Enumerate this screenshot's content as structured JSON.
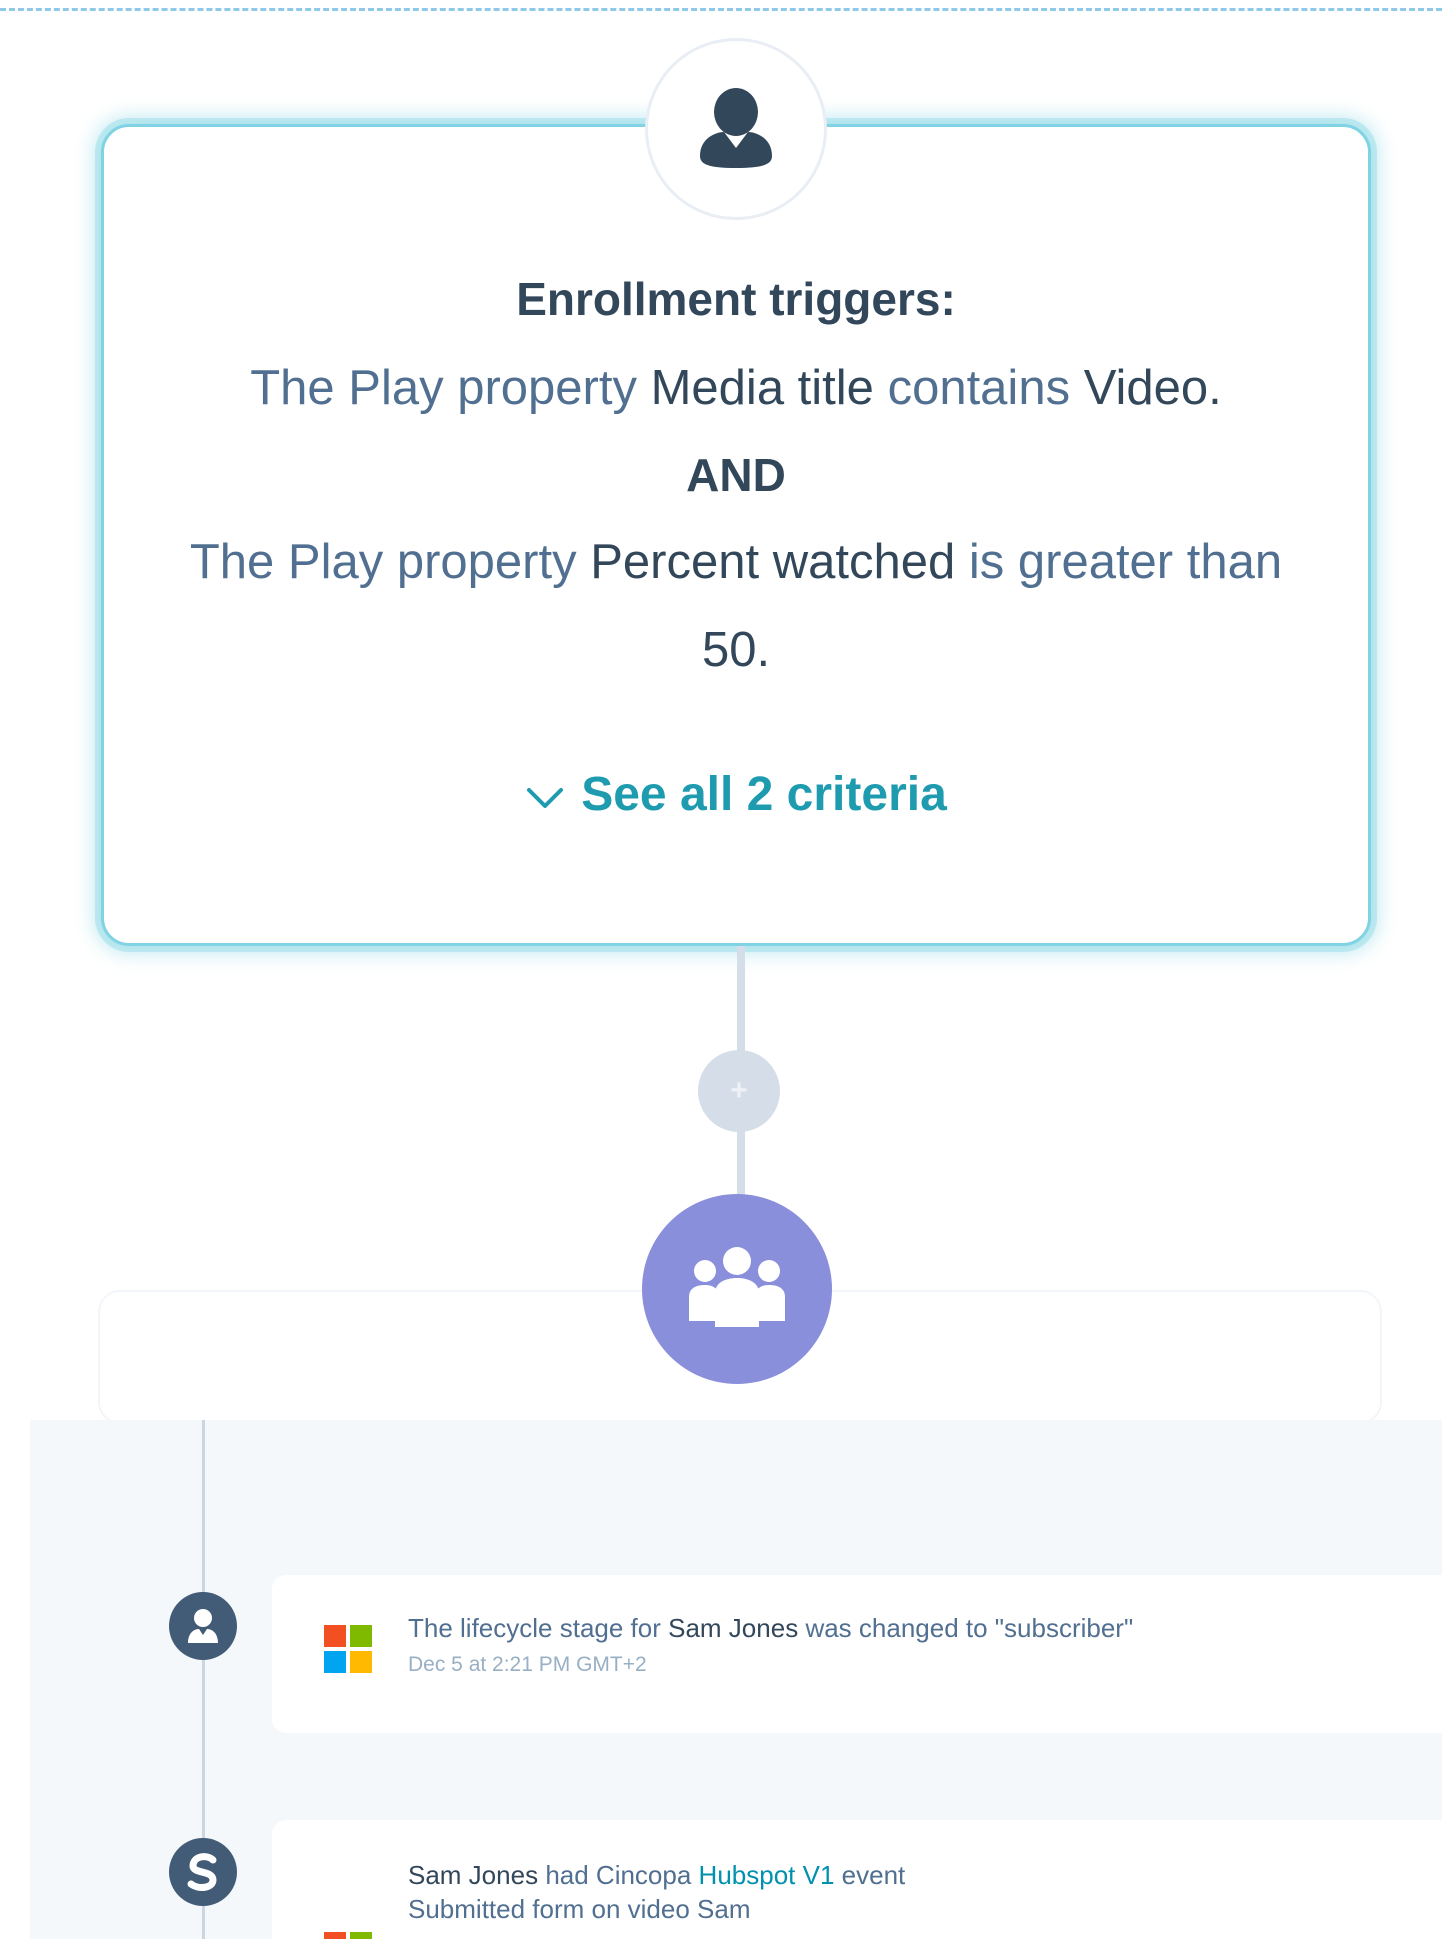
{
  "trigger": {
    "heading": "Enrollment triggers:",
    "criterion_1": {
      "prefix": "The Play property",
      "property": "Media title",
      "operator": "contains",
      "value": "Video."
    },
    "joiner": "AND",
    "criterion_2": {
      "prefix": "The Play property",
      "property": "Percent watched",
      "operator": "is greater than",
      "value": "50."
    },
    "see_all": "See all 2 criteria"
  },
  "timeline": {
    "events": [
      {
        "pre": "The lifecycle stage for",
        "name": "Sam Jones",
        "post": "was changed to \"subscriber\"",
        "timestamp": "Dec 5 at 2:21 PM GMT+2",
        "icon": "contact-icon"
      },
      {
        "name": "Sam Jones",
        "mid": "had Cincopa",
        "link": "Hubspot V1",
        "post": "event",
        "detail": "Submitted form on video Sam",
        "icon": "cincopa-icon"
      }
    ]
  },
  "colors": {
    "accent": "#1f9bb0",
    "card_glow": "#7fd3e3",
    "enrolled_circle": "#8a8fdc",
    "text_dark": "#33475b",
    "text_mid": "#516f90"
  }
}
